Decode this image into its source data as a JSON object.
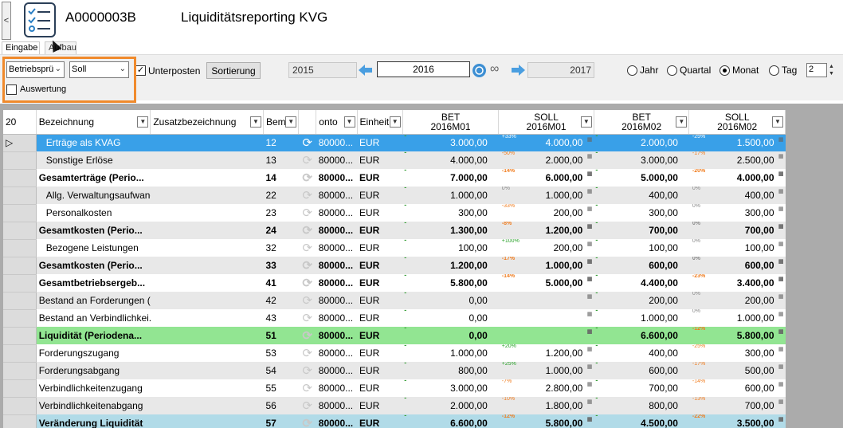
{
  "header": {
    "collapse_glyph": "<",
    "record_id": "A0000003B",
    "title": "Liquiditätsreporting KVG"
  },
  "tabs": [
    {
      "label": "Eingabe"
    },
    {
      "label": "Aufbau"
    }
  ],
  "toolbar": {
    "combo1_value": "Betriebsprü",
    "combo2_value": "Soll",
    "unterposten_label": "Unterposten",
    "unterposten_checked": true,
    "auswertung_label": "Auswertung",
    "auswertung_checked": false,
    "sort_button": "Sortierung",
    "prev_year": "2015",
    "current_year": "2016",
    "next_year": "2017",
    "infinity_glyph": "∞",
    "period_options": [
      "Jahr",
      "Quartal",
      "Monat",
      "Tag"
    ],
    "period_selected": "Monat",
    "spin_value": "2"
  },
  "grid": {
    "row_count_label": "20",
    "columns": {
      "bezeichnung": "Bezeichnung",
      "zusatz": "Zusatzbezeichnung",
      "bem": "Bem",
      "konto": "onto",
      "einheit": "Einheit",
      "bet1_a": "BET",
      "bet1_b": "2016M01",
      "soll1_a": "SOLL",
      "soll1_b": "2016M01",
      "bet2_a": "BET",
      "bet2_b": "2016M02",
      "soll2_a": "SOLL",
      "soll2_b": "2016M02"
    },
    "rows": [
      {
        "indent": true,
        "name": "Erträge als KVAG",
        "nr": "12",
        "konto": "80000...",
        "unit": "EUR",
        "bet1": "3.000,00",
        "pct1": "+33%",
        "soll1": "4.000,00",
        "bet2": "2.000,00",
        "pct2": "-25%",
        "soll2": "1.500,00"
      },
      {
        "indent": true,
        "name": "Sonstige Erlöse",
        "nr": "13",
        "konto": "80000...",
        "unit": "EUR",
        "bet1": "4.000,00",
        "pct1": "-50%",
        "soll1": "2.000,00",
        "bet2": "3.000,00",
        "pct2": "-17%",
        "soll2": "2.500,00"
      },
      {
        "indent": false,
        "name": "Gesamterträge (Perio...",
        "nr": "14",
        "konto": "80000...",
        "unit": "EUR",
        "bet1": "7.000,00",
        "pct1": "-14%",
        "soll1": "6.000,00",
        "bet2": "5.000,00",
        "pct2": "-20%",
        "soll2": "4.000,00"
      },
      {
        "indent": true,
        "name": "Allg. Verwaltungsaufwand",
        "nr": "22",
        "konto": "80000...",
        "unit": "EUR",
        "bet1": "1.000,00",
        "pct1": "0%",
        "soll1": "1.000,00",
        "bet2": "400,00",
        "pct2": "0%",
        "soll2": "400,00"
      },
      {
        "indent": true,
        "name": "Personalkosten",
        "nr": "23",
        "konto": "80000...",
        "unit": "EUR",
        "bet1": "300,00",
        "pct1": "-33%",
        "soll1": "200,00",
        "bet2": "300,00",
        "pct2": "0%",
        "soll2": "300,00"
      },
      {
        "indent": false,
        "name": "Gesamtkosten (Perio...",
        "nr": "24",
        "konto": "80000...",
        "unit": "EUR",
        "bet1": "1.300,00",
        "pct1": "-8%",
        "soll1": "1.200,00",
        "bet2": "700,00",
        "pct2": "0%",
        "soll2": "700,00"
      },
      {
        "indent": true,
        "name": "Bezogene Leistungen",
        "nr": "32",
        "konto": "80000...",
        "unit": "EUR",
        "bet1": "100,00",
        "pct1": "+100%",
        "soll1": "200,00",
        "bet2": "100,00",
        "pct2": "0%",
        "soll2": "100,00"
      },
      {
        "indent": false,
        "name": "Gesamtkosten (Perio...",
        "nr": "33",
        "konto": "80000...",
        "unit": "EUR",
        "bet1": "1.200,00",
        "pct1": "-17%",
        "soll1": "1.000,00",
        "bet2": "600,00",
        "pct2": "0%",
        "soll2": "600,00"
      },
      {
        "indent": false,
        "name": "Gesamtbetriebsergeb...",
        "nr": "41",
        "konto": "80000...",
        "unit": "EUR",
        "bet1": "5.800,00",
        "pct1": "-14%",
        "soll1": "5.000,00",
        "bet2": "4.400,00",
        "pct2": "-23%",
        "soll2": "3.400,00"
      },
      {
        "indent": false,
        "name": "Bestand an Forderungen (...",
        "nr": "42",
        "konto": "80000...",
        "unit": "EUR",
        "bet1": "0,00",
        "pct1": "",
        "soll1": "",
        "bet2": "200,00",
        "pct2": "0%",
        "soll2": "200,00"
      },
      {
        "indent": false,
        "name": "Bestand an Verbindlichkei...",
        "nr": "43",
        "konto": "80000...",
        "unit": "EUR",
        "bet1": "0,00",
        "pct1": "",
        "soll1": "",
        "bet2": "1.000,00",
        "pct2": "0%",
        "soll2": "1.000,00"
      },
      {
        "indent": false,
        "name": "Liquidität (Periodena...",
        "nr": "51",
        "konto": "80000...",
        "unit": "EUR",
        "bet1": "0,00",
        "pct1": "",
        "soll1": "",
        "bet2": "6.600,00",
        "pct2": "-12%",
        "soll2": "5.800,00"
      },
      {
        "indent": false,
        "name": "Forderungszugang",
        "nr": "53",
        "konto": "80000...",
        "unit": "EUR",
        "bet1": "1.000,00",
        "pct1": "+20%",
        "soll1": "1.200,00",
        "bet2": "400,00",
        "pct2": "-25%",
        "soll2": "300,00"
      },
      {
        "indent": false,
        "name": "Forderungsabgang",
        "nr": "54",
        "konto": "80000...",
        "unit": "EUR",
        "bet1": "800,00",
        "pct1": "+25%",
        "soll1": "1.000,00",
        "bet2": "600,00",
        "pct2": "-17%",
        "soll2": "500,00"
      },
      {
        "indent": false,
        "name": "Verbindlichkeitenzugang",
        "nr": "55",
        "konto": "80000...",
        "unit": "EUR",
        "bet1": "3.000,00",
        "pct1": "-7%",
        "soll1": "2.800,00",
        "bet2": "700,00",
        "pct2": "-14%",
        "soll2": "600,00"
      },
      {
        "indent": false,
        "name": "Verbindlichkeitenabgang",
        "nr": "56",
        "konto": "80000...",
        "unit": "EUR",
        "bet1": "2.000,00",
        "pct1": "-10%",
        "soll1": "1.800,00",
        "bet2": "800,00",
        "pct2": "-13%",
        "soll2": "700,00"
      },
      {
        "indent": false,
        "name": "Veränderung Liquidität",
        "nr": "57",
        "konto": "80000...",
        "unit": "EUR",
        "bet1": "6.600,00",
        "pct1": "-12%",
        "soll1": "5.800,00",
        "bet2": "4.500,00",
        "pct2": "-22%",
        "soll2": "3.500,00"
      }
    ]
  },
  "colors": {
    "orange_highlight": "#f08a2c",
    "selected_row": "#39a0e8",
    "green_row": "#92e592",
    "blue_row": "#b1dbe8"
  }
}
